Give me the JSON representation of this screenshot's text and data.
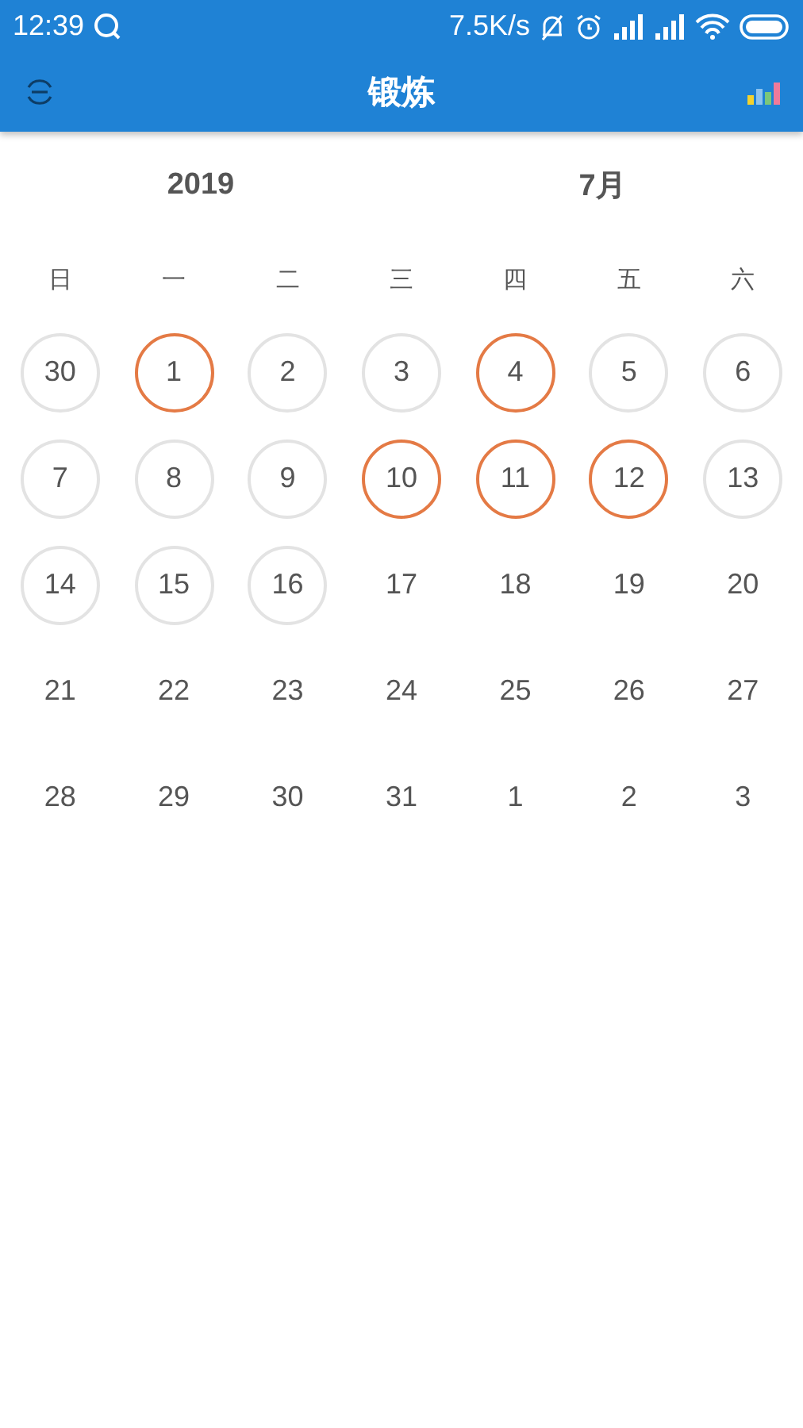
{
  "status_bar": {
    "time": "12:39",
    "speed": "7.5K/s"
  },
  "app_bar": {
    "title": "锻炼"
  },
  "header": {
    "year": "2019",
    "month": "7月"
  },
  "weekdays": [
    "日",
    "一",
    "二",
    "三",
    "四",
    "五",
    "六"
  ],
  "days": [
    {
      "label": "30",
      "ringed": true,
      "completed": false
    },
    {
      "label": "1",
      "ringed": true,
      "completed": true
    },
    {
      "label": "2",
      "ringed": true,
      "completed": false
    },
    {
      "label": "3",
      "ringed": true,
      "completed": false
    },
    {
      "label": "4",
      "ringed": true,
      "completed": true
    },
    {
      "label": "5",
      "ringed": true,
      "completed": false
    },
    {
      "label": "6",
      "ringed": true,
      "completed": false
    },
    {
      "label": "7",
      "ringed": true,
      "completed": false
    },
    {
      "label": "8",
      "ringed": true,
      "completed": false
    },
    {
      "label": "9",
      "ringed": true,
      "completed": false
    },
    {
      "label": "10",
      "ringed": true,
      "completed": true
    },
    {
      "label": "11",
      "ringed": true,
      "completed": true
    },
    {
      "label": "12",
      "ringed": true,
      "completed": true
    },
    {
      "label": "13",
      "ringed": true,
      "completed": false
    },
    {
      "label": "14",
      "ringed": true,
      "completed": false
    },
    {
      "label": "15",
      "ringed": true,
      "completed": false
    },
    {
      "label": "16",
      "ringed": true,
      "completed": false
    },
    {
      "label": "17",
      "ringed": false,
      "completed": false
    },
    {
      "label": "18",
      "ringed": false,
      "completed": false
    },
    {
      "label": "19",
      "ringed": false,
      "completed": false
    },
    {
      "label": "20",
      "ringed": false,
      "completed": false
    },
    {
      "label": "21",
      "ringed": false,
      "completed": false
    },
    {
      "label": "22",
      "ringed": false,
      "completed": false
    },
    {
      "label": "23",
      "ringed": false,
      "completed": false
    },
    {
      "label": "24",
      "ringed": false,
      "completed": false
    },
    {
      "label": "25",
      "ringed": false,
      "completed": false
    },
    {
      "label": "26",
      "ringed": false,
      "completed": false
    },
    {
      "label": "27",
      "ringed": false,
      "completed": false
    },
    {
      "label": "28",
      "ringed": false,
      "completed": false
    },
    {
      "label": "29",
      "ringed": false,
      "completed": false
    },
    {
      "label": "30",
      "ringed": false,
      "completed": false
    },
    {
      "label": "31",
      "ringed": false,
      "completed": false
    },
    {
      "label": "1",
      "ringed": false,
      "completed": false
    },
    {
      "label": "2",
      "ringed": false,
      "completed": false
    },
    {
      "label": "3",
      "ringed": false,
      "completed": false
    }
  ]
}
